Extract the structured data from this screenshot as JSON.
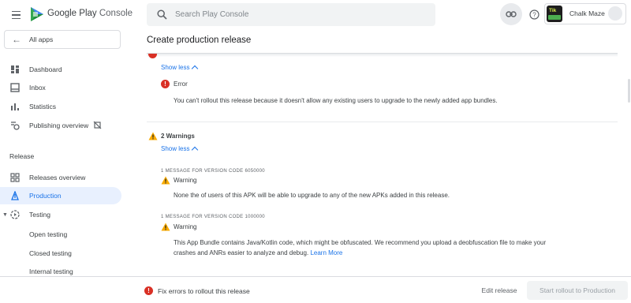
{
  "header": {
    "brand_prefix": "Google Play",
    "brand_suffix": "Console",
    "search_placeholder": "Search Play Console",
    "app_name": "Chalk Maze",
    "app_icon_text": "Tik"
  },
  "sidebar": {
    "all_apps": "All apps",
    "items": [
      {
        "label": "Dashboard"
      },
      {
        "label": "Inbox"
      },
      {
        "label": "Statistics"
      },
      {
        "label": "Publishing overview"
      }
    ],
    "release_section": "Release",
    "release_items": [
      {
        "label": "Releases overview"
      },
      {
        "label": "Production"
      },
      {
        "label": "Testing"
      }
    ],
    "testing_sub": [
      {
        "label": "Open testing"
      },
      {
        "label": "Closed testing"
      },
      {
        "label": "Internal testing"
      }
    ]
  },
  "main": {
    "title": "Create production release",
    "errors": {
      "show_less": "Show less",
      "error_label": "Error",
      "error_text": "You can't rollout this release because it doesn't allow any existing users to upgrade to the newly added app bundles."
    },
    "warnings": {
      "title": "2 Warnings",
      "show_less": "Show less",
      "items": [
        {
          "version_caption": "1 MESSAGE FOR VERSION CODE 6050000",
          "label": "Warning",
          "text": "None the of users of this APK will be able to upgrade to any of the new APKs added in this release."
        },
        {
          "version_caption": "1 MESSAGE FOR VERSION CODE 1000000",
          "label": "Warning",
          "text_line1": "This App Bundle contains Java/Kotlin code, which might be obfuscated. We recommend you upload a deobfuscation file to make your",
          "text_line2": "crashes and ANRs easier to analyze and debug.",
          "link": "Learn More"
        }
      ]
    }
  },
  "footer": {
    "message": "Fix errors to rollout this release",
    "edit_release": "Edit release",
    "start_rollout": "Start rollout to Production"
  },
  "colors": {
    "accent": "#1a73e8",
    "error": "#d93025",
    "warning": "#f9ab00"
  }
}
